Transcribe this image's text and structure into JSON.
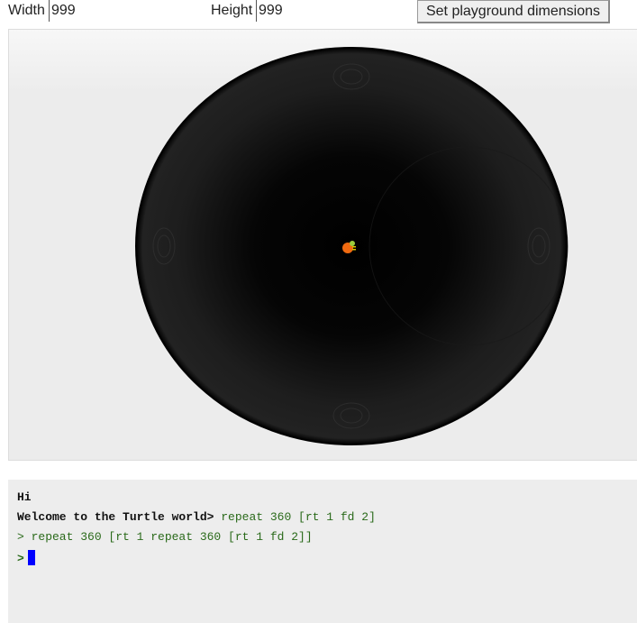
{
  "controls": {
    "width_label": "Width",
    "width_value": "999",
    "height_label": "Height",
    "height_value": "999",
    "set_button": "Set playground dimensions"
  },
  "terminal": {
    "line1": "Hi",
    "line2_prefix": "Welcome to the Turtle world>",
    "line2_cmd": " repeat 360 [rt 1 fd 2]",
    "line3": "> repeat 360 [rt 1 repeat 360 [rt 1 fd 2]]",
    "prompt": ">"
  },
  "colors": {
    "cursor": "#0000ff",
    "command": "#2a6a1a"
  }
}
